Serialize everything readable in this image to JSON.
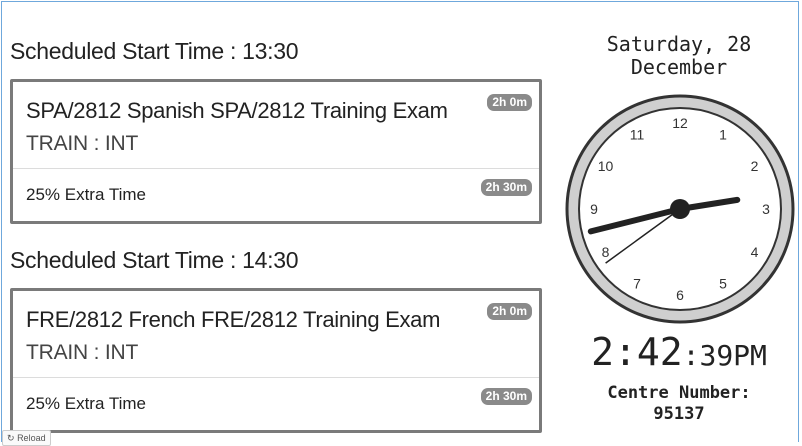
{
  "sessions": [
    {
      "scheduled_label": "Scheduled Start Time : 13:30",
      "exam_title": "SPA/2812 Spanish SPA/2812 Training Exam",
      "exam_duration": "2h 0m",
      "exam_sub": "TRAIN : INT",
      "extra_label": "25% Extra Time",
      "extra_duration": "2h 30m"
    },
    {
      "scheduled_label": "Scheduled Start Time : 14:30",
      "exam_title": "FRE/2812 French FRE/2812 Training Exam",
      "exam_duration": "2h 0m",
      "exam_sub": "TRAIN : INT",
      "extra_label": "25% Extra Time",
      "extra_duration": "2h 30m"
    }
  ],
  "clock_panel": {
    "date_line1": "Saturday, 28",
    "date_line2": "December",
    "time_hm": "2:42",
    "time_sec": ":39PM",
    "centre_label": "Centre Number:",
    "centre_number": "95137",
    "clock_numbers": [
      "12",
      "1",
      "2",
      "3",
      "4",
      "5",
      "6",
      "7",
      "8",
      "9",
      "10",
      "11"
    ],
    "clock_time": {
      "hours": 2,
      "minutes": 42,
      "seconds": 39
    }
  },
  "reload": {
    "icon": "refresh-icon",
    "label": "Reload"
  },
  "colors": {
    "card_border": "#7a7a7a",
    "badge_bg": "#8a8a8a",
    "frame_border": "#6fa8dc"
  }
}
